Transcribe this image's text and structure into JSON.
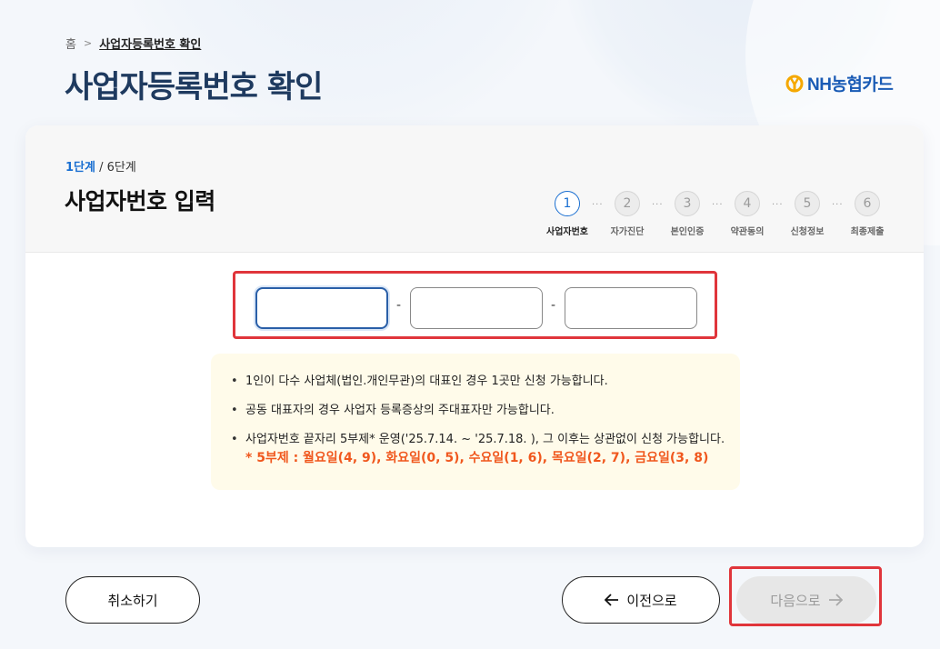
{
  "breadcrumb": {
    "home": "홈",
    "current": "사업자등록번호 확인"
  },
  "page": {
    "title": "사업자등록번호 확인"
  },
  "brand": {
    "logo_text": "NH농협카드",
    "color": "#1a5bb5",
    "mark_color": "#f5a800"
  },
  "stepper_header": {
    "current": "1단계",
    "total": " / 6단계",
    "section_title": "사업자번호 입력"
  },
  "steps": [
    {
      "num": "1",
      "label": "사업자번호",
      "active": true
    },
    {
      "num": "2",
      "label": "자가진단",
      "active": false
    },
    {
      "num": "3",
      "label": "본인인증",
      "active": false
    },
    {
      "num": "4",
      "label": "약관동의",
      "active": false
    },
    {
      "num": "5",
      "label": "신청정보",
      "active": false
    },
    {
      "num": "6",
      "label": "최종제출",
      "active": false
    }
  ],
  "step_separator": "···",
  "bizno_inputs": {
    "part1": {
      "value": "",
      "placeholder": ""
    },
    "part2": {
      "value": "",
      "placeholder": ""
    },
    "part3": {
      "value": "",
      "placeholder": ""
    },
    "separator": "-"
  },
  "notice": {
    "items": [
      "1인이 다수 사업체(법인.개인무관)의 대표인 경우 1곳만 신청 가능합니다.",
      "공동 대표자의 경우 사업자 등록증상의 주대표자만 가능합니다.",
      "사업자번호 끝자리 5부제* 운영('25.7.14. ~ '25.7.18. ), 그 이후는 상관없이 신청 가능합니다."
    ],
    "highlight": "* 5부제 : 월요일(4, 9), 화요일(0, 5), 수요일(1, 6), 목요일(2, 7), 금요일(3, 8)",
    "highlight_color": "#f0571d"
  },
  "buttons": {
    "cancel": "취소하기",
    "prev": "이전으로",
    "next": "다음으로"
  },
  "colors": {
    "accent": "#1a6fd1",
    "title": "#1e3a5f",
    "highlight_frame": "#e0353b"
  }
}
